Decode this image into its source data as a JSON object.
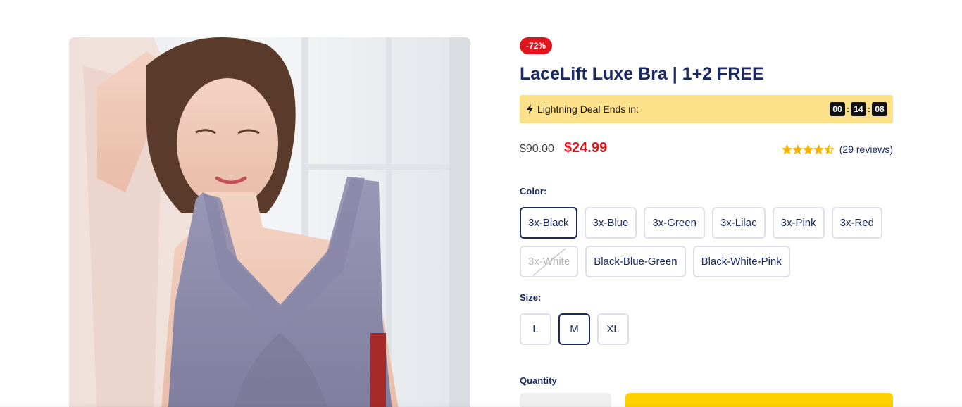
{
  "product": {
    "image_alt": "product-photo-lavender-lace-bra",
    "discount_badge": "-72%",
    "title": "LaceLift Luxe Bra | 1+2 FREE"
  },
  "deal": {
    "label": "Lightning Deal Ends in:",
    "icon": "lightning-bolt-icon",
    "hours": "00",
    "minutes": "14",
    "seconds": "08",
    "separator": ":"
  },
  "price": {
    "old": "$90.00",
    "new": "$24.99"
  },
  "rating": {
    "value": 4.5,
    "reviews": "(29 reviews)",
    "star_color": "#f5b301"
  },
  "color_option": {
    "label": "Color:",
    "options": [
      {
        "label": "3x-Black",
        "selected": true,
        "available": true
      },
      {
        "label": "3x-Blue",
        "selected": false,
        "available": true
      },
      {
        "label": "3x-Green",
        "selected": false,
        "available": true
      },
      {
        "label": "3x-Lilac",
        "selected": false,
        "available": true
      },
      {
        "label": "3x-Pink",
        "selected": false,
        "available": true
      },
      {
        "label": "3x-Red",
        "selected": false,
        "available": true
      },
      {
        "label": "3x-White",
        "selected": false,
        "available": false
      },
      {
        "label": "Black-Blue-Green",
        "selected": false,
        "available": true
      },
      {
        "label": "Black-White-Pink",
        "selected": false,
        "available": true
      }
    ]
  },
  "size_option": {
    "label": "Size:",
    "options": [
      {
        "label": "L",
        "selected": false
      },
      {
        "label": "M",
        "selected": true
      },
      {
        "label": "XL",
        "selected": false
      }
    ]
  },
  "quantity": {
    "label": "Quantity"
  },
  "colors": {
    "brand_navy": "#1b2a63",
    "sale_red": "#e0141c",
    "deal_yellow": "#fde18a",
    "cart_yellow": "#ffd000"
  }
}
